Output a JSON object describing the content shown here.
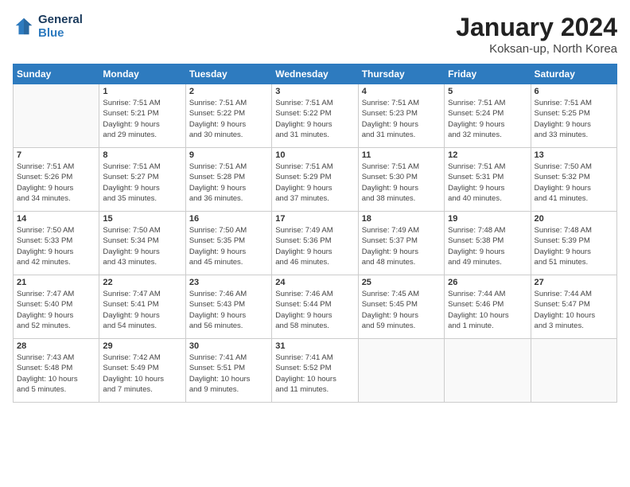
{
  "logo": {
    "line1": "General",
    "line2": "Blue"
  },
  "title": "January 2024",
  "location": "Koksan-up, North Korea",
  "days_of_week": [
    "Sunday",
    "Monday",
    "Tuesday",
    "Wednesday",
    "Thursday",
    "Friday",
    "Saturday"
  ],
  "weeks": [
    [
      {
        "day": "",
        "info": ""
      },
      {
        "day": "1",
        "info": "Sunrise: 7:51 AM\nSunset: 5:21 PM\nDaylight: 9 hours\nand 29 minutes."
      },
      {
        "day": "2",
        "info": "Sunrise: 7:51 AM\nSunset: 5:22 PM\nDaylight: 9 hours\nand 30 minutes."
      },
      {
        "day": "3",
        "info": "Sunrise: 7:51 AM\nSunset: 5:22 PM\nDaylight: 9 hours\nand 31 minutes."
      },
      {
        "day": "4",
        "info": "Sunrise: 7:51 AM\nSunset: 5:23 PM\nDaylight: 9 hours\nand 31 minutes."
      },
      {
        "day": "5",
        "info": "Sunrise: 7:51 AM\nSunset: 5:24 PM\nDaylight: 9 hours\nand 32 minutes."
      },
      {
        "day": "6",
        "info": "Sunrise: 7:51 AM\nSunset: 5:25 PM\nDaylight: 9 hours\nand 33 minutes."
      }
    ],
    [
      {
        "day": "7",
        "info": "Sunrise: 7:51 AM\nSunset: 5:26 PM\nDaylight: 9 hours\nand 34 minutes."
      },
      {
        "day": "8",
        "info": "Sunrise: 7:51 AM\nSunset: 5:27 PM\nDaylight: 9 hours\nand 35 minutes."
      },
      {
        "day": "9",
        "info": "Sunrise: 7:51 AM\nSunset: 5:28 PM\nDaylight: 9 hours\nand 36 minutes."
      },
      {
        "day": "10",
        "info": "Sunrise: 7:51 AM\nSunset: 5:29 PM\nDaylight: 9 hours\nand 37 minutes."
      },
      {
        "day": "11",
        "info": "Sunrise: 7:51 AM\nSunset: 5:30 PM\nDaylight: 9 hours\nand 38 minutes."
      },
      {
        "day": "12",
        "info": "Sunrise: 7:51 AM\nSunset: 5:31 PM\nDaylight: 9 hours\nand 40 minutes."
      },
      {
        "day": "13",
        "info": "Sunrise: 7:50 AM\nSunset: 5:32 PM\nDaylight: 9 hours\nand 41 minutes."
      }
    ],
    [
      {
        "day": "14",
        "info": "Sunrise: 7:50 AM\nSunset: 5:33 PM\nDaylight: 9 hours\nand 42 minutes."
      },
      {
        "day": "15",
        "info": "Sunrise: 7:50 AM\nSunset: 5:34 PM\nDaylight: 9 hours\nand 43 minutes."
      },
      {
        "day": "16",
        "info": "Sunrise: 7:50 AM\nSunset: 5:35 PM\nDaylight: 9 hours\nand 45 minutes."
      },
      {
        "day": "17",
        "info": "Sunrise: 7:49 AM\nSunset: 5:36 PM\nDaylight: 9 hours\nand 46 minutes."
      },
      {
        "day": "18",
        "info": "Sunrise: 7:49 AM\nSunset: 5:37 PM\nDaylight: 9 hours\nand 48 minutes."
      },
      {
        "day": "19",
        "info": "Sunrise: 7:48 AM\nSunset: 5:38 PM\nDaylight: 9 hours\nand 49 minutes."
      },
      {
        "day": "20",
        "info": "Sunrise: 7:48 AM\nSunset: 5:39 PM\nDaylight: 9 hours\nand 51 minutes."
      }
    ],
    [
      {
        "day": "21",
        "info": "Sunrise: 7:47 AM\nSunset: 5:40 PM\nDaylight: 9 hours\nand 52 minutes."
      },
      {
        "day": "22",
        "info": "Sunrise: 7:47 AM\nSunset: 5:41 PM\nDaylight: 9 hours\nand 54 minutes."
      },
      {
        "day": "23",
        "info": "Sunrise: 7:46 AM\nSunset: 5:43 PM\nDaylight: 9 hours\nand 56 minutes."
      },
      {
        "day": "24",
        "info": "Sunrise: 7:46 AM\nSunset: 5:44 PM\nDaylight: 9 hours\nand 58 minutes."
      },
      {
        "day": "25",
        "info": "Sunrise: 7:45 AM\nSunset: 5:45 PM\nDaylight: 9 hours\nand 59 minutes."
      },
      {
        "day": "26",
        "info": "Sunrise: 7:44 AM\nSunset: 5:46 PM\nDaylight: 10 hours\nand 1 minute."
      },
      {
        "day": "27",
        "info": "Sunrise: 7:44 AM\nSunset: 5:47 PM\nDaylight: 10 hours\nand 3 minutes."
      }
    ],
    [
      {
        "day": "28",
        "info": "Sunrise: 7:43 AM\nSunset: 5:48 PM\nDaylight: 10 hours\nand 5 minutes."
      },
      {
        "day": "29",
        "info": "Sunrise: 7:42 AM\nSunset: 5:49 PM\nDaylight: 10 hours\nand 7 minutes."
      },
      {
        "day": "30",
        "info": "Sunrise: 7:41 AM\nSunset: 5:51 PM\nDaylight: 10 hours\nand 9 minutes."
      },
      {
        "day": "31",
        "info": "Sunrise: 7:41 AM\nSunset: 5:52 PM\nDaylight: 10 hours\nand 11 minutes."
      },
      {
        "day": "",
        "info": ""
      },
      {
        "day": "",
        "info": ""
      },
      {
        "day": "",
        "info": ""
      }
    ]
  ]
}
